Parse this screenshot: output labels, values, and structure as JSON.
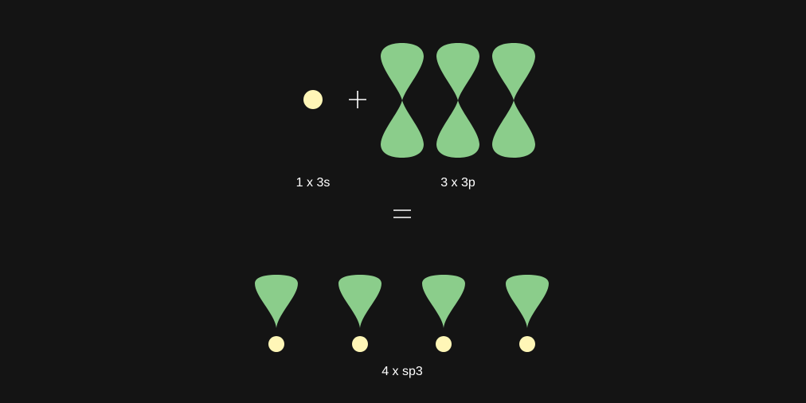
{
  "colors": {
    "background": "#141414",
    "s_orbital": "#fff6b7",
    "p_orbital": "#8bcd8b",
    "operator": "#ffffff",
    "text": "#ffffff"
  },
  "labels": {
    "s_term": "1 x 3s",
    "p_term": "3 x 3p",
    "result": "4 x sp3"
  },
  "operators": {
    "plus": "plus-sign",
    "equals": "equals-sign"
  },
  "counts": {
    "s_orbitals": 1,
    "p_orbitals": 3,
    "sp3_orbitals": 4
  }
}
